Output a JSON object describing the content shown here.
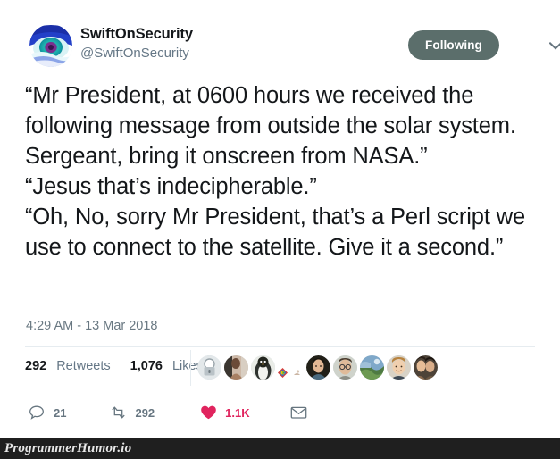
{
  "tweet": {
    "author": {
      "display_name": "SwiftOnSecurity",
      "handle": "@SwiftOnSecurity",
      "avatar_icon": "eye-avatar"
    },
    "follow_button": {
      "label": "Following",
      "color": "#5b6e6b",
      "text_color": "#ffffff"
    },
    "caret_icon": "chevron-down-icon",
    "body": "“Mr President, at 0600 hours we received the following message from outside the solar system. Sergeant, bring it onscreen from NASA.”\n“Jesus that’s indecipherable.”\n“Oh, No, sorry Mr President, that’s a Perl script we use to connect to the satellite. Give it a second.”",
    "timestamp": "4:29 AM - 13 Mar 2018",
    "stats": {
      "retweets_count": "292",
      "retweets_label": "Retweets",
      "likes_count": "1,076",
      "likes_label": "Likes"
    },
    "facepile": [
      {
        "name": "liker-avatar-1",
        "kind": "lock-badge"
      },
      {
        "name": "liker-avatar-2",
        "kind": "photo-person-a"
      },
      {
        "name": "liker-avatar-3",
        "kind": "penguin"
      },
      {
        "name": "liker-avatar-4",
        "kind": "tiny-colorful-a"
      },
      {
        "name": "liker-avatar-5",
        "kind": "tiny-colorful-b"
      },
      {
        "name": "liker-avatar-6",
        "kind": "photo-person-b"
      },
      {
        "name": "liker-avatar-7",
        "kind": "photo-person-glasses"
      },
      {
        "name": "liker-avatar-8",
        "kind": "photo-landscape"
      },
      {
        "name": "liker-avatar-9",
        "kind": "photo-person-c"
      },
      {
        "name": "liker-avatar-10",
        "kind": "photo-couple"
      }
    ],
    "actions": {
      "reply": {
        "icon": "reply-icon",
        "count": "21"
      },
      "retweet": {
        "icon": "retweet-icon",
        "count": "292"
      },
      "like": {
        "icon": "heart-icon",
        "count": "1.1K",
        "color": "#e0245e"
      },
      "share": {
        "icon": "envelope-icon",
        "count": ""
      }
    }
  },
  "watermark": {
    "text": "ProgrammerHumor.io",
    "background": "#1f1f1f",
    "color": "#e8e8e8"
  }
}
